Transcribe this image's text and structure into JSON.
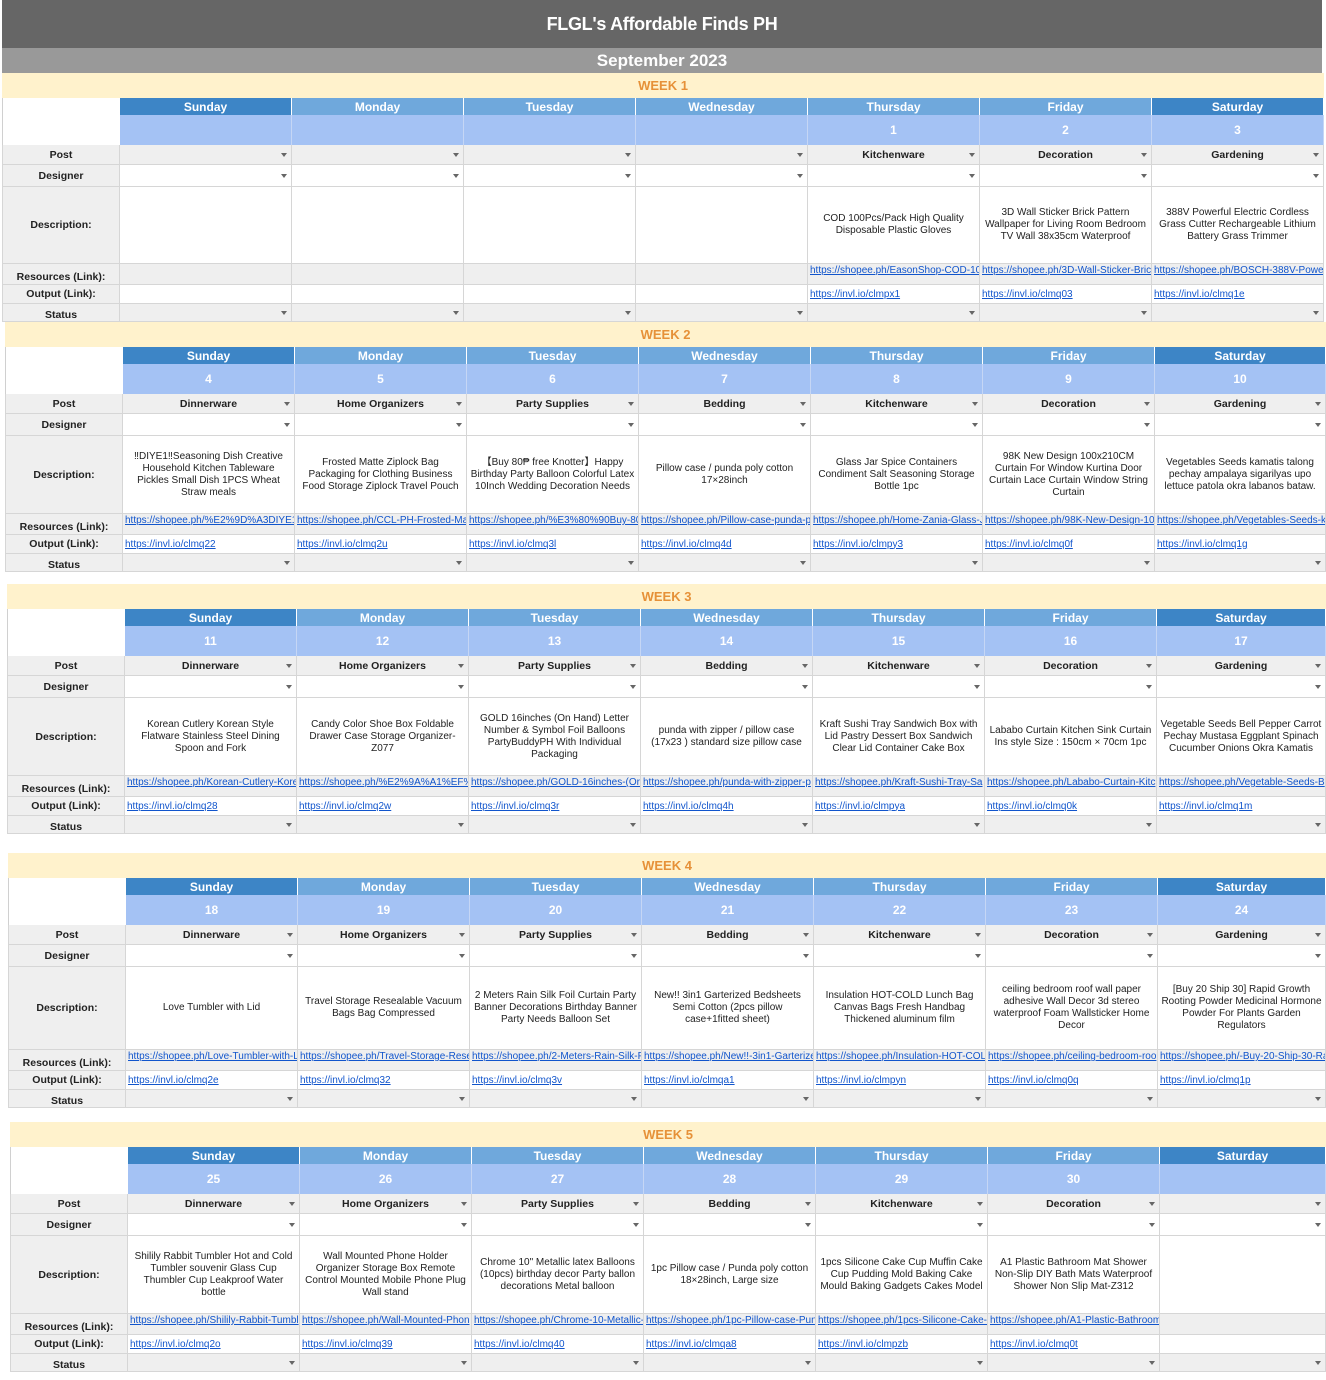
{
  "title": "FLGL's Affordable Finds PH",
  "month": "September 2023",
  "days": [
    "Sunday",
    "Monday",
    "Tuesday",
    "Wednesday",
    "Thursday",
    "Friday",
    "Saturday"
  ],
  "labels": {
    "post": "Post",
    "designer": "Designer",
    "description": "Description:",
    "resources": "Resources (Link):",
    "output": "Output (Link):",
    "status": "Status"
  },
  "weeks": [
    {
      "title": "WEEK 1",
      "dates": [
        "",
        "",
        "",
        "",
        "1",
        "2",
        "3"
      ],
      "post": [
        "",
        "",
        "",
        "",
        "Kitchenware",
        "Decoration",
        "Gardening"
      ],
      "desc": [
        "",
        "",
        "",
        "",
        "COD 100Pcs/Pack High Quality Disposable Plastic Gloves",
        "3D Wall Sticker Brick Pattern Wallpaper for Living Room Bedroom TV Wall 38x35cm Waterproof",
        "388V Powerful Electric Cordless Grass Cutter Rechargeable Lithium Battery Grass Trimmer"
      ],
      "res": [
        "",
        "",
        "",
        "",
        "https://shopee.ph/EasonShop-COD-10",
        "https://shopee.ph/3D-Wall-Sticker-Bric",
        "https://shopee.ph/BOSCH-388V-Powe"
      ],
      "out": [
        "",
        "",
        "",
        "",
        "https://invl.io/clmpx1",
        "https://invl.io/clmq03",
        "https://invl.io/clmq1e"
      ]
    },
    {
      "title": "WEEK 2",
      "dates": [
        "4",
        "5",
        "6",
        "7",
        "8",
        "9",
        "10"
      ],
      "post": [
        "Dinnerware",
        "Home Organizers",
        "Party Supplies",
        "Bedding",
        "Kitchenware",
        "Decoration",
        "Gardening"
      ],
      "desc": [
        "‼DIYE1‼Seasoning Dish Creative Household Kitchen Tableware Pickles Small Dish 1PCS Wheat Straw meals",
        "Frosted Matte Ziplock Bag Packaging for Clothing Business Food Storage Ziplock Travel Pouch",
        "【Buy 80₱ free Knotter】Happy Birthday Party Balloon Colorful Latex 10Inch Wedding Decoration Needs",
        "Pillow case / punda poly cotton 17×28inch",
        "Glass Jar Spice Containers Condiment Salt Seasoning Storage Bottle 1pc",
        "98K New Design 100x210CM Curtain For Window Kurtina Door Curtain Lace Curtain Window String Curtain",
        "Vegetables Seeds kamatis talong pechay ampalaya sigarilyas upo lettuce patola okra labanos bataw."
      ],
      "res": [
        "https://shopee.ph/%E2%9D%A3DIYE1",
        "https://shopee.ph/CCL-PH-Frosted-Ma",
        "https://shopee.ph/%E3%80%90Buy-80",
        "https://shopee.ph/Pillow-case-punda-p",
        "https://shopee.ph/Home-Zania-Glass-J",
        "https://shopee.ph/98K-New-Design-10",
        "https://shopee.ph/Vegetables-Seeds-k"
      ],
      "out": [
        "https://invl.io/clmq22",
        "https://invl.io/clmq2u",
        "https://invl.io/clmq3l",
        "https://invl.io/clmq4d",
        "https://invl.io/clmpy3",
        "https://invl.io/clmq0f",
        "https://invl.io/clmq1g"
      ]
    },
    {
      "title": "WEEK 3",
      "dates": [
        "11",
        "12",
        "13",
        "14",
        "15",
        "16",
        "17"
      ],
      "post": [
        "Dinnerware",
        "Home Organizers",
        "Party Supplies",
        "Bedding",
        "Kitchenware",
        "Decoration",
        "Gardening"
      ],
      "desc": [
        "Korean Cutlery Korean Style Flatware Stainless Steel Dining Spoon and Fork",
        "Candy Color Shoe Box Foldable Drawer Case Storage Organizer-Z077",
        "GOLD 16inches (On Hand) Letter Number & Symbol Foil Balloons PartyBuddyPH With Individual Packaging",
        "punda with zipper / pillow case (17x23 ) standard size pillow case",
        "Kraft Sushi Tray Sandwich Box with Lid Pastry Dessert Box Sandwich Clear Lid Container Cake Box",
        "Lababo Curtain Kitchen Sink Curtain Ins style Size : 150cm × 70cm 1pc",
        "Vegetable Seeds Bell Pepper Carrot Pechay Mustasa Eggplant Spinach Cucumber Onions Okra Kamatis"
      ],
      "res": [
        "https://shopee.ph/Korean-Cutlery-Kore",
        "https://shopee.ph/%E2%9A%A1%EF%",
        "https://shopee.ph/GOLD-16inches-(Or",
        "https://shopee.ph/punda-with-zipper-p",
        "https://shopee.ph/Kraft-Sushi-Tray-Sa",
        "https://shopee.ph/Lababo-Curtain-Kitc",
        "https://shopee.ph/Vegetable-Seeds-B"
      ],
      "out": [
        "https://invl.io/clmq28",
        "https://invl.io/clmq2w",
        "https://invl.io/clmq3r",
        "https://invl.io/clmq4h",
        "https://invl.io/clmpya",
        "https://invl.io/clmq0k",
        "https://invl.io/clmq1m"
      ]
    },
    {
      "title": "WEEK 4",
      "dates": [
        "18",
        "19",
        "20",
        "21",
        "22",
        "23",
        "24"
      ],
      "post": [
        "Dinnerware",
        "Home Organizers",
        "Party Supplies",
        "Bedding",
        "Kitchenware",
        "Decoration",
        "Gardening"
      ],
      "desc": [
        "Love Tumbler with Lid",
        "Travel Storage Resealable Vacuum Bags Bag Compressed",
        "2 Meters Rain Silk Foil Curtain Party Banner Decorations Birthday Banner Party Needs Balloon Set",
        "New!! 3in1 Garterized Bedsheets Semi Cotton (2pcs pillow case+1fitted sheet)",
        "Insulation HOT-COLD Lunch Bag Canvas Bags Fresh Handbag Thickened aluminum film",
        "ceiling bedroom roof wall paper adhesive Wall Decor 3d stereo waterproof Foam Wallsticker Home Decor",
        "[Buy 20 Ship 30] Rapid Growth Rooting Powder Medicinal Hormone Powder For Plants Garden Regulators"
      ],
      "res": [
        "https://shopee.ph/Love-Tumbler-with-L",
        "https://shopee.ph/Travel-Storage-Rese",
        "https://shopee.ph/2-Meters-Rain-Silk-F",
        "https://shopee.ph/New!!-3in1-Garterize",
        "https://shopee.ph/Insulation-HOT-COL",
        "https://shopee.ph/ceiling-bedroom-roo",
        "https://shopee.ph/-Buy-20-Ship-30-Ra"
      ],
      "out": [
        "https://invl.io/clmq2e",
        "https://invl.io/clmq32",
        "https://invl.io/clmq3v",
        "https://invl.io/clmqa1",
        "https://invl.io/clmpyn",
        "https://invl.io/clmq0q",
        "https://invl.io/clmq1p"
      ]
    },
    {
      "title": "WEEK 5",
      "dates": [
        "25",
        "26",
        "27",
        "28",
        "29",
        "30",
        ""
      ],
      "post": [
        "Dinnerware",
        "Home Organizers",
        "Party Supplies",
        "Bedding",
        "Kitchenware",
        "Decoration",
        ""
      ],
      "desc": [
        "Shilily Rabbit Tumbler Hot and Cold Tumbler souvenir Glass Cup Thumbler Cup Leakproof Water bottle",
        "Wall Mounted Phone Holder Organizer Storage Box Remote Control Mounted Mobile Phone Plug Wall stand",
        "Chrome 10\" Metallic latex Balloons (10pcs) birthday decor Party ballon decorations Metal balloon",
        "1pc Pillow case / Punda poly cotton 18×28inch, Large size",
        "1pcs Silicone Cake Cup Muffin Cake Cup Pudding Mold Baking Cake Mould Baking Gadgets Cakes Model",
        "A1 Plastic Bathroom Mat Shower Non-Slip DIY Bath Mats Waterproof Shower Non Slip Mat-Z312",
        ""
      ],
      "res": [
        "https://shopee.ph/Shilily-Rabbit-Tumbl",
        "https://shopee.ph/Wall-Mounted-Phon",
        "https://shopee.ph/Chrome-10-Metallic-",
        "https://shopee.ph/1pc-Pillow-case-Pun",
        "https://shopee.ph/1pcs-Silicone-Cake-",
        "https://shopee.ph/A1-Plastic-Bathroom",
        ""
      ],
      "out": [
        "https://invl.io/clmq2o",
        "https://invl.io/clmq39",
        "https://invl.io/clmq40",
        "https://invl.io/clmqa8",
        "https://invl.io/clmpzb",
        "https://invl.io/clmq0t",
        ""
      ]
    }
  ]
}
